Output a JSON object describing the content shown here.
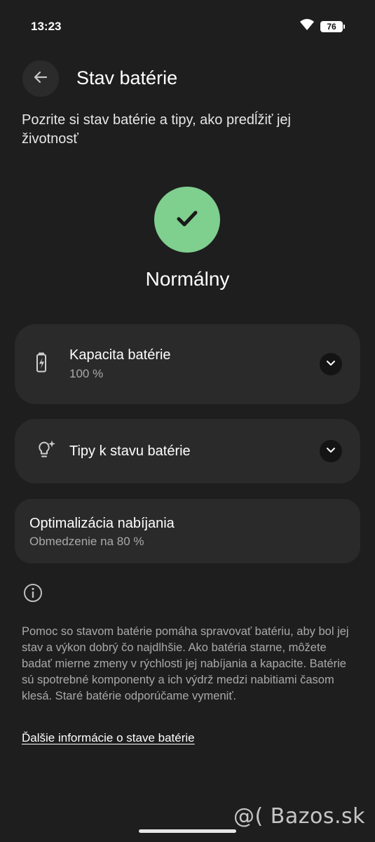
{
  "status_bar": {
    "time": "13:23",
    "battery_level": "76",
    "wifi_icon": "wifi-icon"
  },
  "header": {
    "back_icon": "arrow-back-icon",
    "title": "Stav batérie"
  },
  "subtitle": "Pozrite si stav batérie a tipy, ako predĺžiť jej životnosť",
  "health_status": {
    "icon": "checkmark-icon",
    "label": "Normálny",
    "color": "#7fcf8f"
  },
  "cards": {
    "capacity": {
      "icon": "battery-icon",
      "title": "Kapacita batérie",
      "value": "100 %",
      "expand_icon": "chevron-down-icon"
    },
    "tips": {
      "icon": "lightbulb-icon",
      "title": "Tipy k stavu batérie",
      "expand_icon": "chevron-down-icon"
    },
    "charging_optimization": {
      "title": "Optimalizácia nabíjania",
      "value": "Obmedzenie na 80 %"
    }
  },
  "info": {
    "icon": "info-icon",
    "text": "Pomoc so stavom batérie pomáha spravovať batériu, aby bol jej stav a výkon dobrý čo najdlhšie. Ako batéria starne, môžete badať mierne zmeny v rýchlosti jej nabíjania a kapacite. Batérie sú spotrebné komponenty a ich výdrž medzi nabitiami časom klesá. Staré batérie odporúčame vymeniť.",
    "link": "Ďalšie informácie o stave batérie"
  },
  "watermark": "@( Bazos.sk",
  "colors": {
    "background": "#1e1e1e",
    "card": "#2a2a2a",
    "accent_green": "#7fcf8f"
  }
}
